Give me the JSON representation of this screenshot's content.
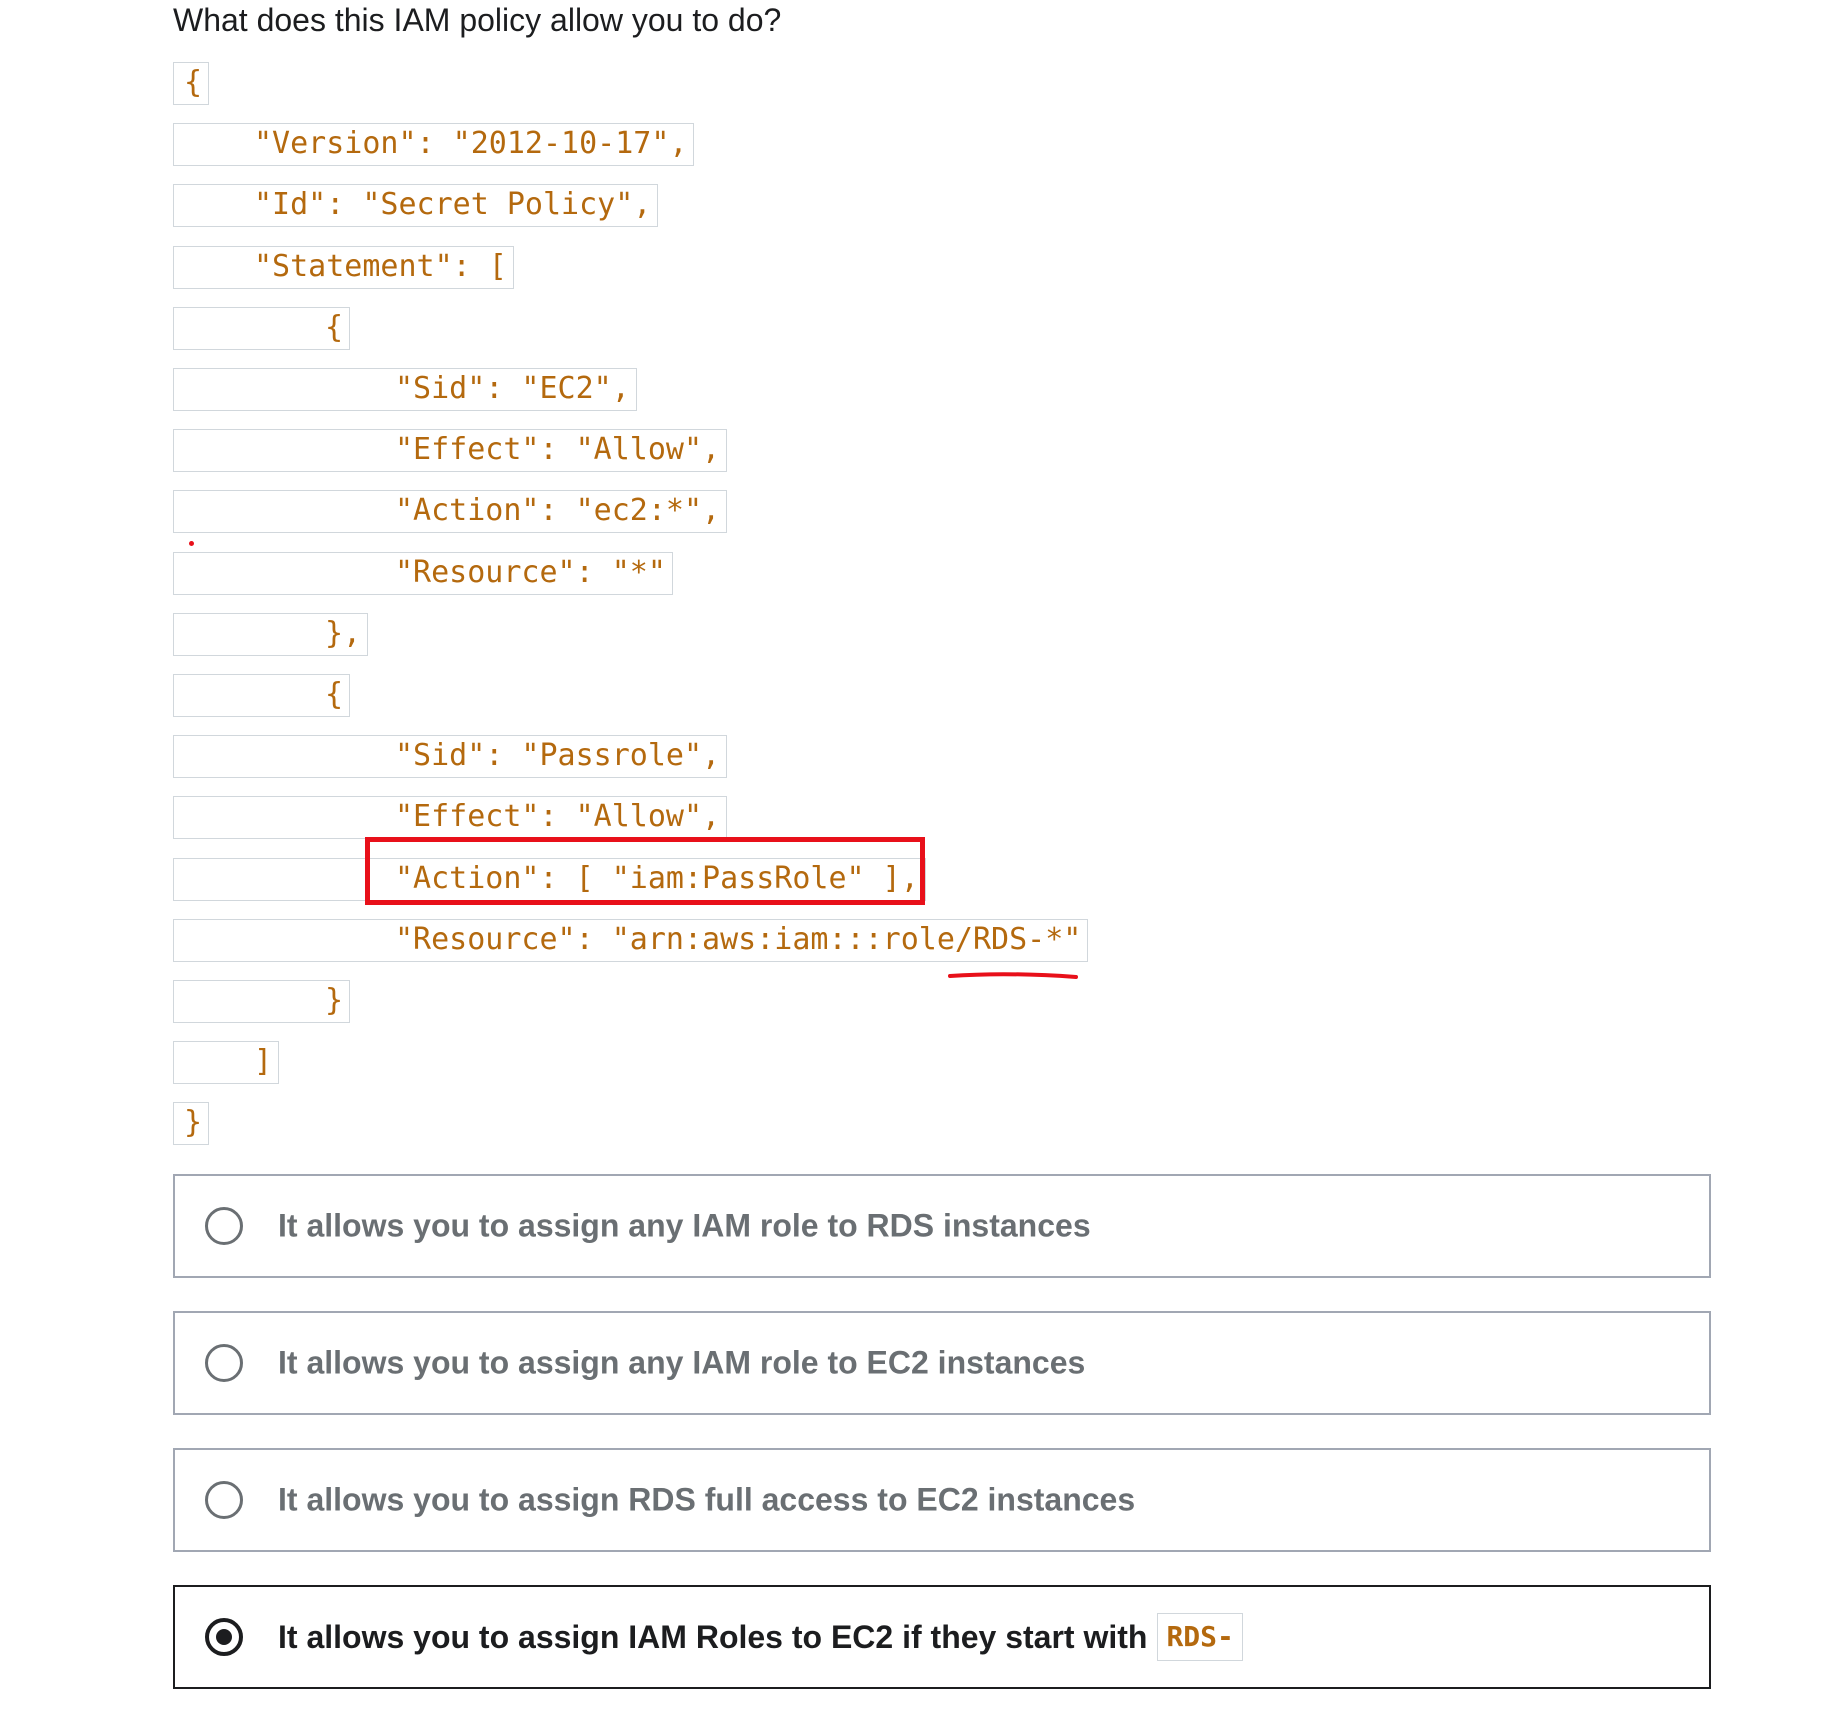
{
  "question": {
    "text": "What does this IAM policy allow you to do?"
  },
  "code": {
    "lines": [
      {
        "indent": 0,
        "text": "{"
      },
      {
        "indent": 4,
        "text": "\"Version\": \"2012-10-17\","
      },
      {
        "indent": 4,
        "text": "\"Id\": \"Secret Policy\","
      },
      {
        "indent": 4,
        "text": "\"Statement\": ["
      },
      {
        "indent": 8,
        "text": "{"
      },
      {
        "indent": 12,
        "text": "\"Sid\": \"EC2\","
      },
      {
        "indent": 12,
        "text": "\"Effect\": \"Allow\","
      },
      {
        "indent": 12,
        "text": "\"Action\": \"ec2:*\","
      },
      {
        "indent": 12,
        "text": "\"Resource\": \"*\""
      },
      {
        "indent": 8,
        "text": "},"
      },
      {
        "indent": 8,
        "text": "{"
      },
      {
        "indent": 12,
        "text": "\"Sid\": \"Passrole\","
      },
      {
        "indent": 12,
        "text": "\"Effect\": \"Allow\","
      },
      {
        "indent": 12,
        "text": "\"Action\": [ \"iam:PassRole\" ],"
      },
      {
        "indent": 12,
        "text": "\"Resource\": \"arn:aws:iam:::role/RDS-*\""
      },
      {
        "indent": 8,
        "text": "}"
      },
      {
        "indent": 4,
        "text": "]"
      },
      {
        "indent": 0,
        "text": "}"
      }
    ]
  },
  "options": [
    {
      "label": "It allows you to assign any IAM role to RDS instances",
      "selected": false
    },
    {
      "label": "It allows you to assign any IAM role to EC2 instances",
      "selected": false
    },
    {
      "label": "It allows you to assign RDS full access to EC2 instances",
      "selected": false
    },
    {
      "label": "It allows you to assign IAM Roles to EC2 if they start with",
      "code": "RDS-",
      "selected": true
    }
  ],
  "colors": {
    "code_text": "#b4690e",
    "annotation_red": "#e8101a",
    "selected_border": "#1c1d1f",
    "unselected_text": "#6a6f73"
  }
}
